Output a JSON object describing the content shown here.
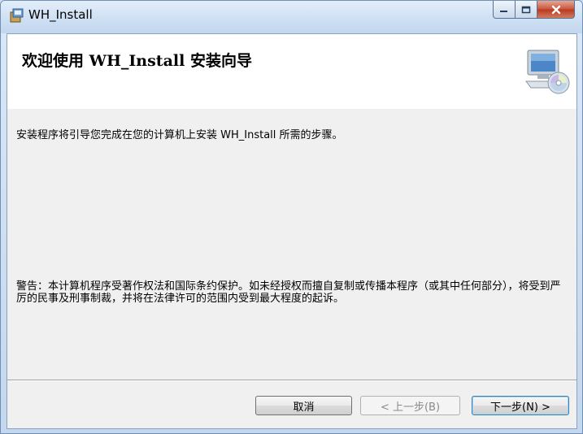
{
  "window": {
    "title": "WH_Install"
  },
  "banner": {
    "title": "欢迎使用 WH_Install 安装向导"
  },
  "content": {
    "intro": "安装程序将引导您完成在您的计算机上安装 WH_Install 所需的步骤。",
    "warning": "警告：本计算机程序受著作权法和国际条约保护。如未经授权而擅自复制或传播本程序（或其中任何部分），将受到严厉的民事及刑事制裁，并将在法律许可的范围内受到最大程度的起诉。"
  },
  "buttons": {
    "cancel": "取消",
    "back": "< 上一步(B)",
    "next": "下一步(N) >"
  },
  "icons": {
    "app": "installer-box-icon",
    "banner": "computer-cd-icon",
    "minimize": "minimize-icon",
    "maximize": "maximize-icon",
    "close": "close-icon"
  }
}
